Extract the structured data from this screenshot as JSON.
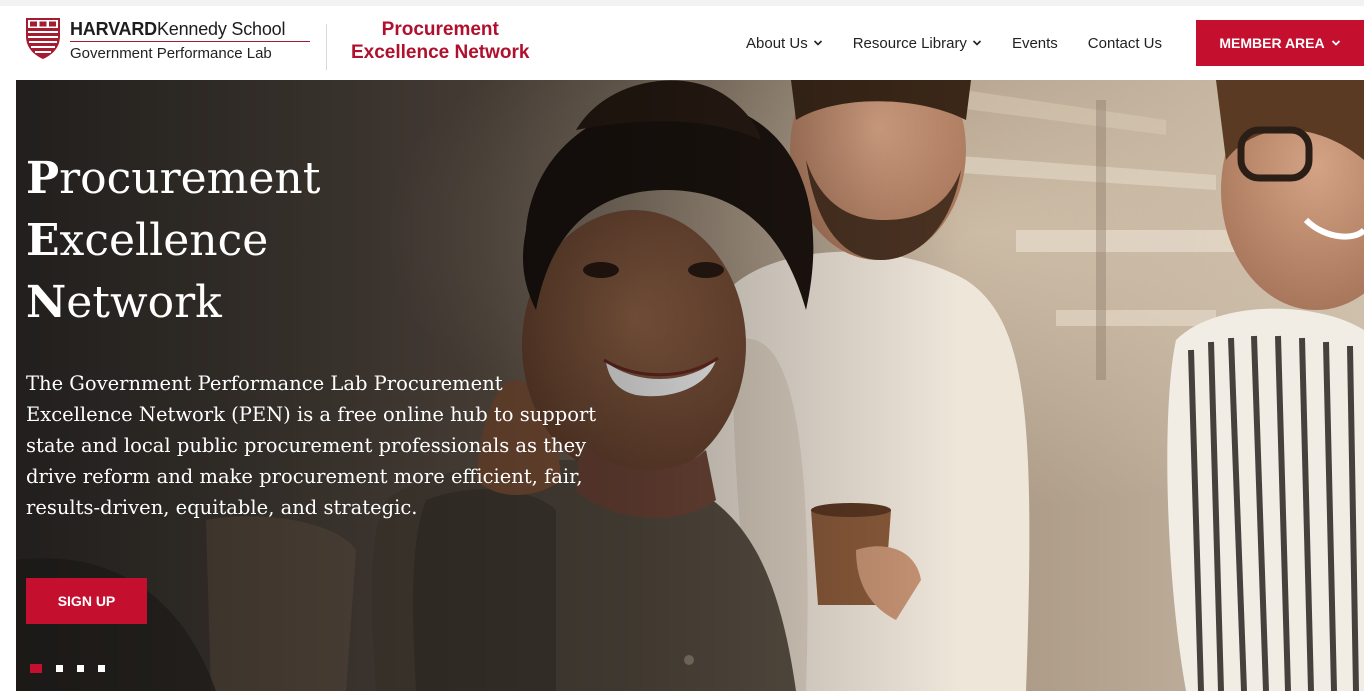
{
  "colors": {
    "brand_crimson": "#c4102e",
    "pen_title_color": "#b0102e",
    "nav_text": "#222222",
    "hero_text": "#ffffff"
  },
  "header": {
    "hks_logo": {
      "name_bold": "HARVARD",
      "name_rest": "Kennedy School",
      "subtitle": "Government Performance Lab",
      "icon": "harvard-shield-icon"
    },
    "pen_brand": {
      "line1": "Procurement",
      "line2": "Excellence Network"
    },
    "nav": [
      {
        "label": "About Us",
        "has_dropdown": true
      },
      {
        "label": "Resource Library",
        "has_dropdown": true
      },
      {
        "label": "Events",
        "has_dropdown": false
      },
      {
        "label": "Contact Us",
        "has_dropdown": false
      }
    ],
    "member_button": {
      "label": "MEMBER AREA",
      "has_dropdown": true
    }
  },
  "hero": {
    "title_lines": [
      {
        "cap": "P",
        "rest": "rocurement"
      },
      {
        "cap": "E",
        "rest": "xcellence"
      },
      {
        "cap": "N",
        "rest": "etwork"
      }
    ],
    "description_lines": [
      "The Government Performance Lab Procurement",
      "Excellence Network (PEN) is a free online hub to support",
      "state and local public procurement professionals as they",
      "drive reform and make procurement more efficient, fair,",
      "results-driven, equitable, and strategic."
    ],
    "signup_label": "SIGN UP",
    "carousel": {
      "slide_count": 4,
      "active_index": 0
    }
  }
}
